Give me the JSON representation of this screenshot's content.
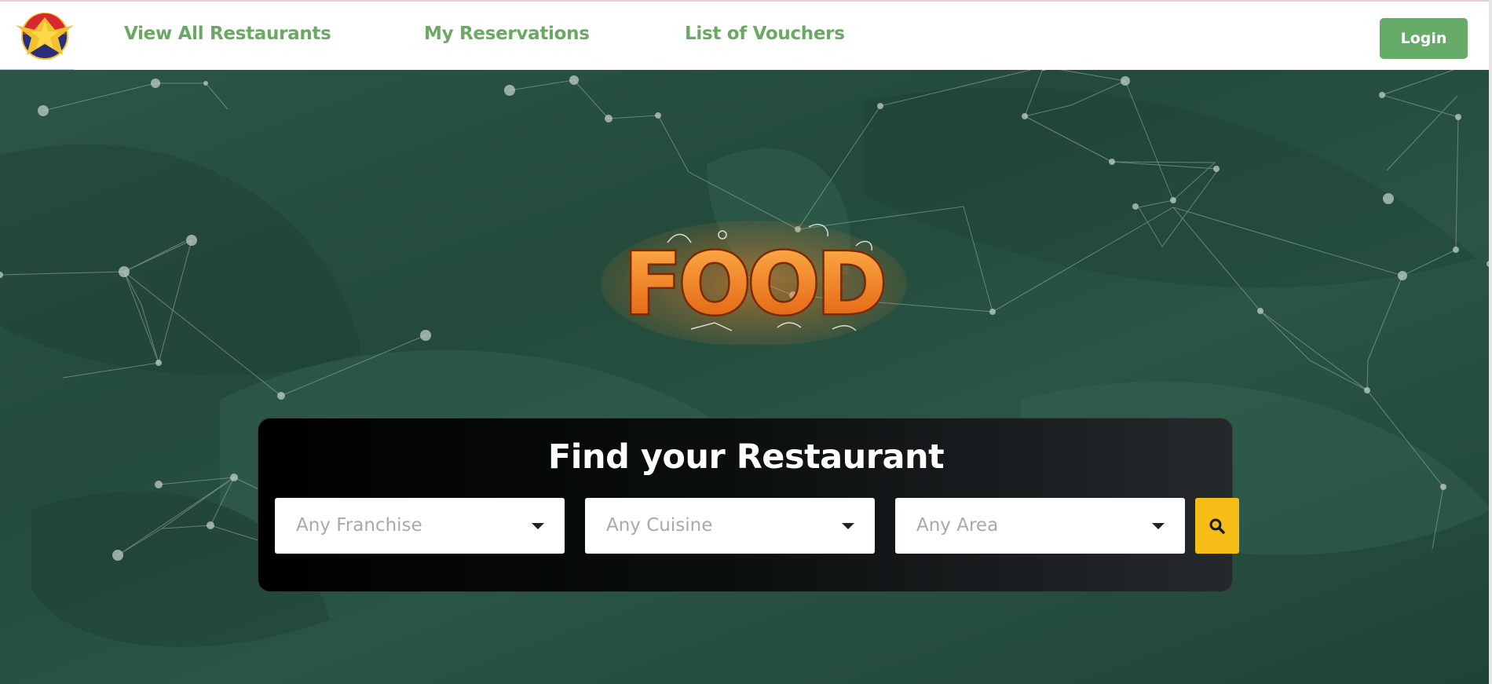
{
  "navbar": {
    "links": [
      "View All Restaurants",
      "My Reservations",
      "List of Vouchers"
    ],
    "login_label": "Login"
  },
  "hero": {
    "logo_text": "FOOD"
  },
  "search": {
    "title": "Find your Restaurant",
    "franchise_placeholder": "Any Franchise",
    "cuisine_placeholder": "Any Cuisine",
    "area_placeholder": "Any Area",
    "search_icon": "search-icon"
  },
  "colors": {
    "nav_link": "#6aa864",
    "login_button": "#67ab68",
    "search_button": "#f6bd16",
    "hero_green": "#2d5646"
  }
}
